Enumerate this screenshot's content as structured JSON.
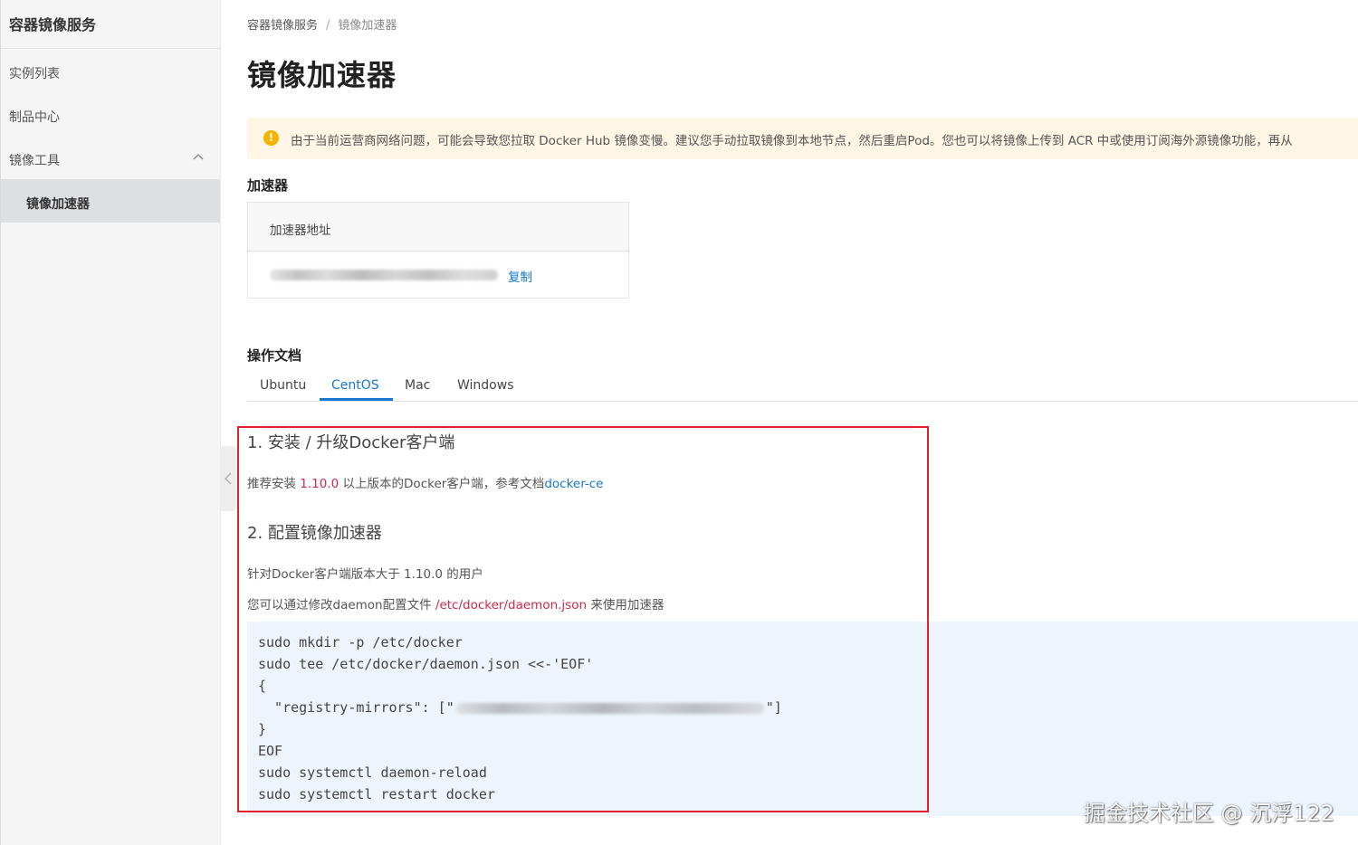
{
  "sidebar": {
    "title": "容器镜像服务",
    "items": [
      {
        "label": "实例列表"
      },
      {
        "label": "制品中心"
      },
      {
        "label": "镜像工具"
      }
    ],
    "sub_item": "镜像加速器"
  },
  "breadcrumb": {
    "root": "容器镜像服务",
    "separator": "/",
    "current": "镜像加速器"
  },
  "page_title": "镜像加速器",
  "notice": {
    "icon": "warning-icon",
    "text": "由于当前运营商网络问题，可能会导致您拉取 Docker Hub 镜像变慢。建议您手动拉取镜像到本地节点，然后重启Pod。您也可以将镜像上传到 ACR 中或使用订阅海外源镜像功能，再从"
  },
  "accelerator": {
    "section_title": "加速器",
    "column_header": "加速器地址",
    "copy_label": "复制"
  },
  "docs": {
    "section_title": "操作文档",
    "tabs": [
      "Ubuntu",
      "CentOS",
      "Mac",
      "Windows"
    ],
    "active_tab": "CentOS"
  },
  "content": {
    "step1_title": "1. 安装 / 升级Docker客户端",
    "step1_prefix": "推荐安装 ",
    "step1_version": "1.10.0",
    "step1_middle": " 以上版本的Docker客户端，参考文档",
    "step1_link": "docker-ce",
    "step2_title": "2. 配置镜像加速器",
    "step2_line1": "针对Docker客户端版本大于 1.10.0 的用户",
    "step2_line2_prefix": "您可以通过修改daemon配置文件 ",
    "step2_path": "/etc/docker/daemon.json",
    "step2_line2_suffix": " 来使用加速器",
    "code": {
      "l1": "sudo mkdir -p /etc/docker",
      "l2": "sudo tee /etc/docker/daemon.json <<-'EOF'",
      "l3": "{",
      "l4_prefix": "  \"registry-mirrors\": [\"",
      "l4_suffix": "\"]",
      "l5": "}",
      "l6": "EOF",
      "l7": "sudo systemctl daemon-reload",
      "l8": "sudo systemctl restart docker"
    }
  },
  "watermark": "掘金技术社区 @ 沉浮122",
  "colors": {
    "accent": "#1677d2",
    "highlight_frame": "#e3202a",
    "notice_bg": "#fff6e5",
    "code_bg": "#eef4fb"
  }
}
